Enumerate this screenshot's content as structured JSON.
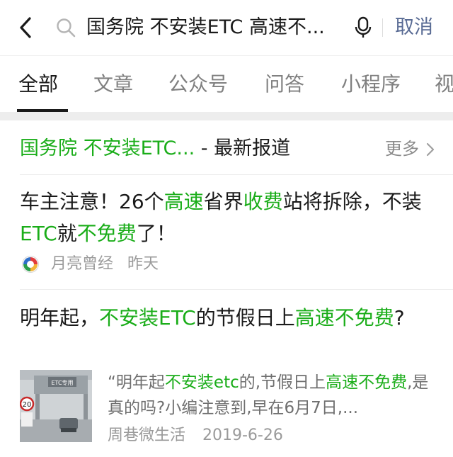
{
  "search": {
    "query": "国务院 不安装ETC 高速不...",
    "cancel_label": "取消"
  },
  "tabs": [
    {
      "label": "全部",
      "active": true
    },
    {
      "label": "文章",
      "active": false
    },
    {
      "label": "公众号",
      "active": false
    },
    {
      "label": "问答",
      "active": false
    },
    {
      "label": "小程序",
      "active": false
    },
    {
      "label": "视",
      "active": false
    }
  ],
  "section": {
    "title_highlight": "国务院 不安装ETC...",
    "title_suffix": " - 最新报道",
    "more_label": "更多"
  },
  "articles": [
    {
      "title_parts": [
        {
          "text": "车主注意！26个",
          "hl": false
        },
        {
          "text": "高速",
          "hl": true
        },
        {
          "text": "省界",
          "hl": false
        },
        {
          "text": "收费",
          "hl": true
        },
        {
          "text": "站将拆除，不装",
          "hl": false
        },
        {
          "text": "ETC",
          "hl": true
        },
        {
          "text": "就",
          "hl": false
        },
        {
          "text": "不免费",
          "hl": true
        },
        {
          "text": "了！",
          "hl": false
        }
      ],
      "source": "月亮曾经",
      "date": "昨天"
    },
    {
      "title_parts": [
        {
          "text": "明年起，",
          "hl": false
        },
        {
          "text": "不安装ETC",
          "hl": true
        },
        {
          "text": "的节假日上",
          "hl": false
        },
        {
          "text": "高速不免费",
          "hl": true
        },
        {
          "text": "?",
          "hl": false
        }
      ],
      "snippet_parts": [
        {
          "text": "“明年起",
          "hl": false
        },
        {
          "text": "不安装etc",
          "hl": true
        },
        {
          "text": "的,节假日上",
          "hl": false
        },
        {
          "text": "高速不免费",
          "hl": true
        },
        {
          "text": ",是真的吗?小编注意到,早在6月7日,...",
          "hl": false
        }
      ],
      "source": "周巷微生活",
      "date": "2019-6-26",
      "thumb_sign_text": "ETC专用",
      "thumb_speed_text": "20"
    }
  ],
  "colors": {
    "highlight": "#1aad19",
    "cancel": "#596b94",
    "meta": "#9a9a9a"
  }
}
